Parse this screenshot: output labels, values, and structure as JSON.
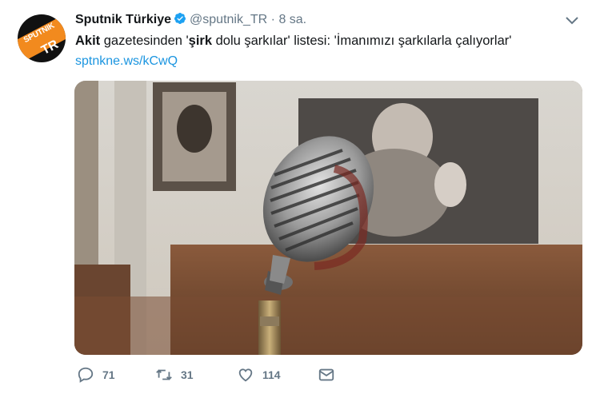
{
  "account": {
    "display_name": "Sputnik Türkiye",
    "handle": "@sputnik_TR",
    "separator": "·",
    "time": "8 sa.",
    "verified": true,
    "avatar_brand": "SPUTNIK",
    "avatar_tr": "TR",
    "avatar_colors": {
      "bg": "#111111",
      "stripe": "#f28a1e"
    }
  },
  "tweet": {
    "text_parts": [
      "Akit",
      " gazetesinden '",
      "şirk",
      " dolu şarkılar' listesi: 'İmanımızı şarkılarla çalıyorlar'"
    ],
    "link": "sptnkne.ws/kCwQ"
  },
  "media": {
    "icons": [
      "microphone"
    ]
  },
  "actions": {
    "reply_count": "71",
    "retweet_count": "31",
    "like_count": "114"
  },
  "colors": {
    "accent": "#1b95e0",
    "muted": "#657786",
    "text": "#14171a"
  }
}
